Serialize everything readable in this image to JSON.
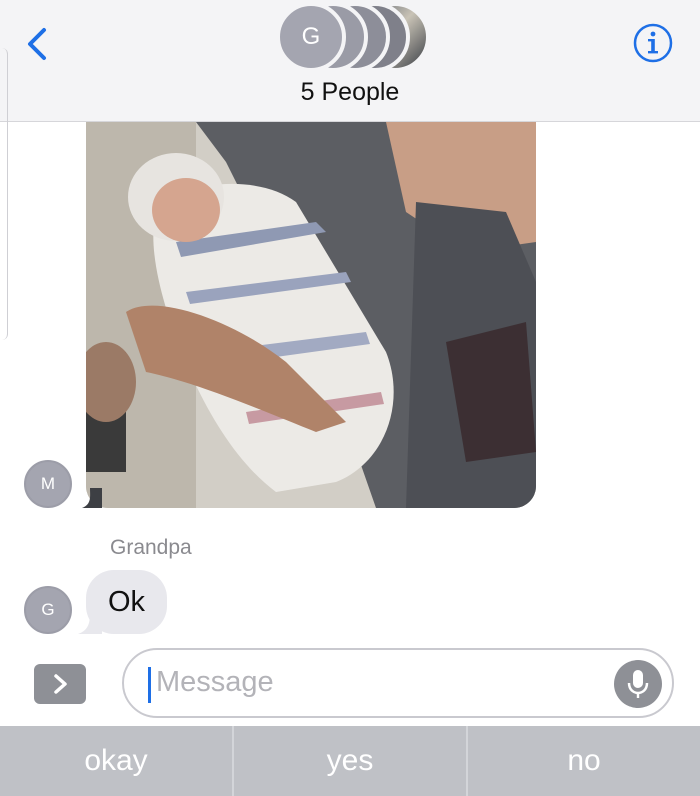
{
  "header": {
    "title": "5 People",
    "group_avatar_initial": "G",
    "back_icon": "chevron-left-icon",
    "info_icon": "info-icon"
  },
  "thread": {
    "photo_sender_initial": "M",
    "sender_name": "Grandpa",
    "sender_initial": "G",
    "message_text": "Ok"
  },
  "composer": {
    "placeholder": "Message",
    "apps_icon": "chevron-right-icon",
    "mic_icon": "microphone-icon"
  },
  "suggestions": [
    "okay",
    "yes",
    "no"
  ],
  "colors": {
    "accent": "#1e6fe6",
    "bubble_gray": "#e8e8ed",
    "avatar_gray": "#a4a5b0"
  }
}
